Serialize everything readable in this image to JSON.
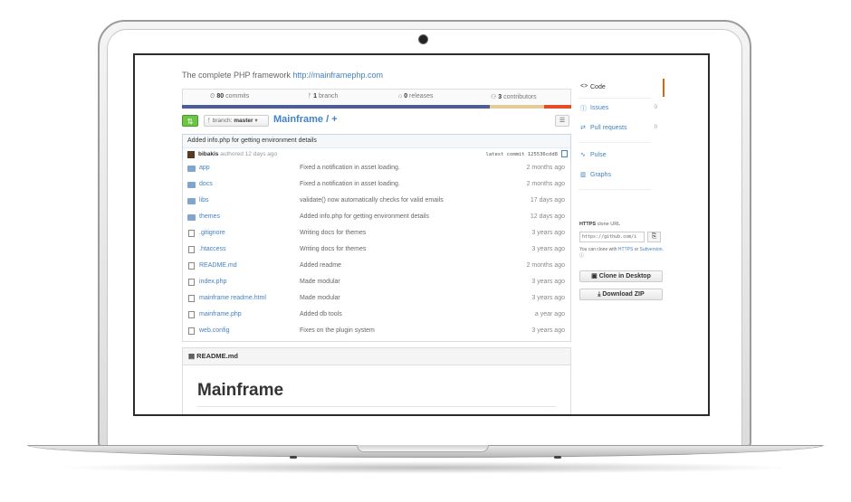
{
  "repo": {
    "description": "The complete PHP framework",
    "homepage": "http://mainframephp.com",
    "stats": {
      "commits_count": "80",
      "commits_label": "commits",
      "branch_count": "1",
      "branch_label": "branch",
      "releases_count": "0",
      "releases_label": "releases",
      "contributors_count": "3",
      "contributors_label": "contributors"
    },
    "language_colors": [
      "#4F5D95",
      "#4F5D95",
      "#e4cc98",
      "#e34c26"
    ],
    "branch_prefix": "branch:",
    "branch_name": "master",
    "breadcrumb": "Mainframe",
    "breadcrumb_sep": "/ +",
    "latest_commit": {
      "message": "Added info.php for getting environment details",
      "author": "bibakis",
      "when": "authored 12 days ago",
      "sha_label": "latest commit 125536cdd8"
    },
    "files": [
      {
        "type": "dir",
        "name": "app",
        "message": "Fixed a notification in asset loading.",
        "age": "2 months ago"
      },
      {
        "type": "dir",
        "name": "docs",
        "message": "Fixed a notification in asset loading.",
        "age": "2 months ago"
      },
      {
        "type": "dir",
        "name": "libs",
        "message": "validate() now automatically checks for valid emails",
        "age": "17 days ago"
      },
      {
        "type": "dir",
        "name": "themes",
        "message": "Added info.php for getting environment details",
        "age": "12 days ago"
      },
      {
        "type": "file",
        "name": ".gitignore",
        "message": "Writing docs for themes",
        "age": "3 years ago"
      },
      {
        "type": "file",
        "name": ".htaccess",
        "message": "Writing docs for themes",
        "age": "3 years ago"
      },
      {
        "type": "file",
        "name": "README.md",
        "message": "Added readme",
        "age": "2 months ago"
      },
      {
        "type": "file",
        "name": "index.php",
        "message": "Made modular",
        "age": "3 years ago"
      },
      {
        "type": "file",
        "name": "mainframe readme.html",
        "message": "Made modular",
        "age": "3 years ago"
      },
      {
        "type": "file",
        "name": "mainframe.php",
        "message": "Added db tools",
        "age": "a year ago"
      },
      {
        "type": "file",
        "name": "web.config",
        "message": "Fixes on the plugin system",
        "age": "3 years ago"
      }
    ],
    "readme": {
      "file": "README.md",
      "heading": "Mainframe"
    }
  },
  "sidebar": {
    "nav": [
      {
        "icon": "<>",
        "label": "Code",
        "count": ""
      },
      {
        "icon": "ⓘ",
        "label": "Issues",
        "count": "0"
      },
      {
        "icon": "⇄",
        "label": "Pull requests",
        "count": "0"
      },
      {
        "icon": "∿",
        "label": "Pulse",
        "count": ""
      },
      {
        "icon": "▥",
        "label": "Graphs",
        "count": ""
      }
    ],
    "clone_protocol": "HTTPS",
    "clone_label": "clone URL",
    "clone_url": "https://github.com/i",
    "clone_note_prefix": "You can clone with",
    "clone_note_https": "HTTPS",
    "clone_note_or": "or",
    "clone_note_svn": "Subversion.",
    "clone_desktop": "Clone in Desktop",
    "download_zip": "Download ZIP"
  }
}
